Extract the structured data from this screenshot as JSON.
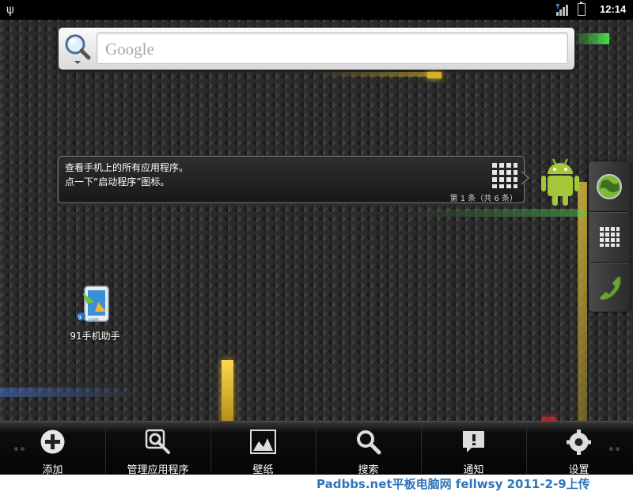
{
  "status_bar": {
    "time": "12:14",
    "icons": [
      "usb-icon",
      "signal-icon",
      "battery-icon"
    ]
  },
  "search": {
    "placeholder": "Google",
    "icon": "search-icon"
  },
  "hint": {
    "line1": "查看手机上的所有应用程序。",
    "line2": "点一下“启动程序”图标。",
    "pager": "第 1 条（共 6 条）"
  },
  "dock": {
    "items": [
      "browser-icon",
      "app-launcher-icon",
      "phone-icon"
    ]
  },
  "desktop": {
    "apps": [
      {
        "label": "91手机助手"
      }
    ]
  },
  "menu": {
    "items": [
      {
        "label": "添加",
        "icon": "add-icon"
      },
      {
        "label": "管理应用程序",
        "icon": "manage-apps-icon"
      },
      {
        "label": "壁纸",
        "icon": "wallpaper-icon"
      },
      {
        "label": "搜索",
        "icon": "search-icon"
      },
      {
        "label": "通知",
        "icon": "notification-icon"
      },
      {
        "label": "设置",
        "icon": "settings-icon"
      }
    ]
  },
  "watermark": "Padbbs.net平板电脑网 fellwsy 2011-2-9上传"
}
